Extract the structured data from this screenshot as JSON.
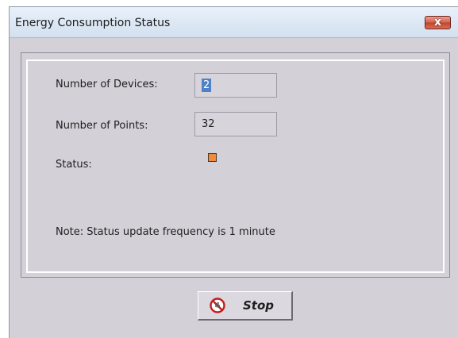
{
  "window": {
    "title": "Energy Consumption Status",
    "close_label": "x"
  },
  "fields": {
    "devices_label": "Number of Devices:",
    "devices_value": "2",
    "points_label": "Number of Points:",
    "points_value": "32",
    "status_label": "Status:",
    "status_color": "#f08a3c"
  },
  "note": "Note: Status update frequency is 1 minute",
  "stop_button": {
    "label": "Stop",
    "icon": "no-entry-icon"
  }
}
